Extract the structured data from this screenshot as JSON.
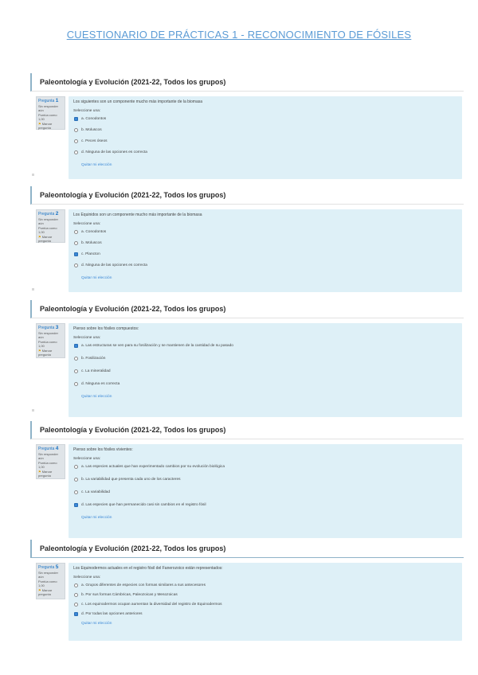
{
  "title": "CUESTIONARIO DE PRÁCTICAS 1 - RECONOCIMIENTO DE FÓSILES",
  "questions": [
    {
      "course": "Paleontología y Evolución (2021-22, Todos los grupos)",
      "label": "Pregunta",
      "number": "1",
      "status": "Sin responder aún",
      "score": "Puntúa como 1,00",
      "flag": "Marcar pregunta",
      "text": "Los siguientes son un componente mucho más importante de la biomasa",
      "select": "Seleccione una:",
      "options": [
        "a. Conodontos",
        "b. Moluscos",
        "c. Peces óseos",
        "d. Ninguna de las opciones es correcta"
      ],
      "checked": 0,
      "feedback": "Quitar mi elección"
    },
    {
      "course": "Paleontología y Evolución (2021-22, Todos los grupos)",
      "label": "Pregunta",
      "number": "2",
      "status": "Sin responder aún",
      "score": "Puntúa como 1,00",
      "flag": "Marcar pregunta",
      "text": "Los Equinidos son un componente mucho más importante de la biomasa",
      "select": "Seleccione una:",
      "options": [
        "a. Conodontos",
        "b. Moluscos",
        "c. Plancton",
        "d. Ninguna de las opciones es correcta"
      ],
      "checked": 2,
      "feedback": "Quitar mi elección"
    },
    {
      "course": "Paleontología y Evolución (2021-22, Todos los grupos)",
      "label": "Pregunta",
      "number": "3",
      "status": "Sin responder aún",
      "score": "Puntúa como 1,00",
      "flag": "Marcar pregunta",
      "text": "Pienso sobre los fósiles compuestos:",
      "select": "Seleccione una:",
      "options": [
        "a. Las estructuras se ven para su fosilización y se mantienen de la cantidad de su pasado",
        "b. Fosilización",
        "c. La mineralidad",
        "d. Ninguna es correcta"
      ],
      "checked": 0,
      "feedback": "Quitar mi elección"
    },
    {
      "course": "Paleontología y Evolución (2021-22, Todos los grupos)",
      "label": "Pregunta",
      "number": "4",
      "status": "Sin responder aún",
      "score": "Puntúa como 1,00",
      "flag": "Marcar pregunta",
      "text": "Pienso sobre los fósiles vivientes:",
      "select": "Seleccione una:",
      "options": [
        "a. Las especies actuales que han experimentado cambios por su evolución biológica",
        "b. La variabilidad que presenta cada uno de los caracteres",
        "c. La variabilidad",
        "d. Las especies que han permanecido casi sin cambios en el registro fósil"
      ],
      "checked": 3,
      "feedback": "Quitar mi elección"
    },
    {
      "course": "Paleontología y Evolución (2021-22, Todos los grupos)",
      "label": "Pregunta",
      "number": "5",
      "status": "Sin responder aún",
      "score": "Puntúa como 1,00",
      "flag": "Marcar pregunta",
      "text": "Los Equinodermos actuales en el registro fósil del Fanerozoico están representados:",
      "select": "Seleccione una:",
      "options": [
        "a. Grupos diferentes de especies con formas similares a sus antecesores",
        "b. Por sus formas Cámbricas, Paleozoicas y Mesozoicas",
        "c. Los equinodermos ocupan aumentan la diversidad del registro de Equinodermos",
        "d. Por todas las opciones anteriores"
      ],
      "checked": 3,
      "feedback": "Quitar mi elección"
    }
  ]
}
